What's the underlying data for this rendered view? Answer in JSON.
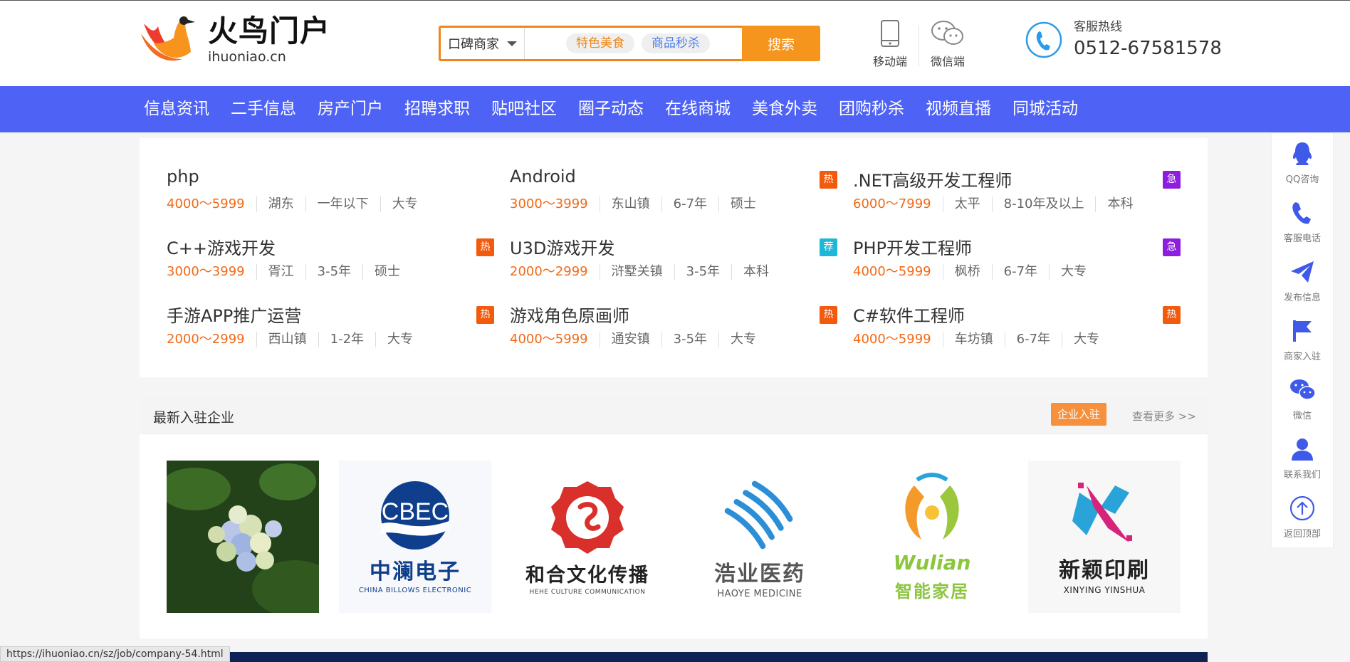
{
  "header": {
    "logo": {
      "cn": "火鸟门户",
      "en": "ihuoniao.cn"
    },
    "search": {
      "select": "口碑商家",
      "chips": [
        "特色美食",
        "商品秒杀"
      ],
      "button": "搜索"
    },
    "qr": [
      {
        "label": "移动端",
        "icon": "mobile-icon"
      },
      {
        "label": "微信端",
        "icon": "wechat-icon"
      }
    ],
    "hotline": {
      "label": "客服热线",
      "number": "0512-67581578"
    }
  },
  "nav": [
    "信息资讯",
    "二手信息",
    "房产门户",
    "招聘求职",
    "贴吧社区",
    "圈子动态",
    "在线商城",
    "美食外卖",
    "团购秒杀",
    "视频直播",
    "同城活动"
  ],
  "jobs": [
    {
      "title": "php",
      "salary": "4000～5999",
      "location": "湖东",
      "exp": "一年以下",
      "edu": "大专",
      "tag": ""
    },
    {
      "title": "Android",
      "salary": "3000～3999",
      "location": "东山镇",
      "exp": "6-7年",
      "edu": "硕士",
      "tag": "热"
    },
    {
      "title": ".NET高级开发工程师",
      "salary": "6000～7999",
      "location": "太平",
      "exp": "8-10年及以上",
      "edu": "本科",
      "tag": "急"
    },
    {
      "title": "C++游戏开发",
      "salary": "3000～3999",
      "location": "胥江",
      "exp": "3-5年",
      "edu": "硕士",
      "tag": "热"
    },
    {
      "title": "U3D游戏开发",
      "salary": "2000～2999",
      "location": "浒墅关镇",
      "exp": "3-5年",
      "edu": "本科",
      "tag": "荐"
    },
    {
      "title": "PHP开发工程师",
      "salary": "4000～5999",
      "location": "枫桥",
      "exp": "6-7年",
      "edu": "大专",
      "tag": "急"
    },
    {
      "title": "手游APP推广运营",
      "salary": "2000～2999",
      "location": "西山镇",
      "exp": "1-2年",
      "edu": "大专",
      "tag": "热"
    },
    {
      "title": "游戏角色原画师",
      "salary": "4000～5999",
      "location": "通安镇",
      "exp": "3-5年",
      "edu": "大专",
      "tag": "热"
    },
    {
      "title": "C#软件工程师",
      "salary": "4000～5999",
      "location": "车坊镇",
      "exp": "6-7年",
      "edu": "大专",
      "tag": "热"
    }
  ],
  "company": {
    "title": "最新入驻企业",
    "join": "企业入驻",
    "more": "查看更多 >>",
    "logos": [
      {
        "kind": "photo",
        "cn": "",
        "en": ""
      },
      {
        "kind": "cbec",
        "cn": "中澜电子",
        "en": "CHINA BILLOWS ELECTRONIC",
        "mark": "CBEC"
      },
      {
        "kind": "hehe",
        "cn": "和合文化传播",
        "en": "HEHE CULTURE COMMUNICATION"
      },
      {
        "kind": "haoye",
        "cn": "浩业医药",
        "en": "HAOYE MEDICINE"
      },
      {
        "kind": "wulian",
        "cn": "智能家居",
        "en": "Wulian"
      },
      {
        "kind": "xinying",
        "cn": "新颖印刷",
        "en": "XINYING YINSHUA"
      }
    ]
  },
  "rail": [
    {
      "label": "QQ咨询",
      "icon": "qq-icon"
    },
    {
      "label": "客服电话",
      "icon": "phone-icon"
    },
    {
      "label": "发布信息",
      "icon": "send-icon"
    },
    {
      "label": "商家入驻",
      "icon": "flag-icon"
    },
    {
      "label": "微信",
      "icon": "wechat-icon"
    },
    {
      "label": "联系我们",
      "icon": "user-icon"
    },
    {
      "label": "返回顶部",
      "icon": "arrow-up-icon"
    }
  ],
  "statusbar": "https://ihuoniao.cn/sz/job/company-54.html",
  "colors": {
    "nav": "#4e63f5",
    "accent": "#f5951d",
    "salary": "#f26a17",
    "hot": "#f25a0e",
    "urgent": "#8e1de0",
    "recommend": "#1bb8d8",
    "icon_blue": "#3f5ae8"
  }
}
